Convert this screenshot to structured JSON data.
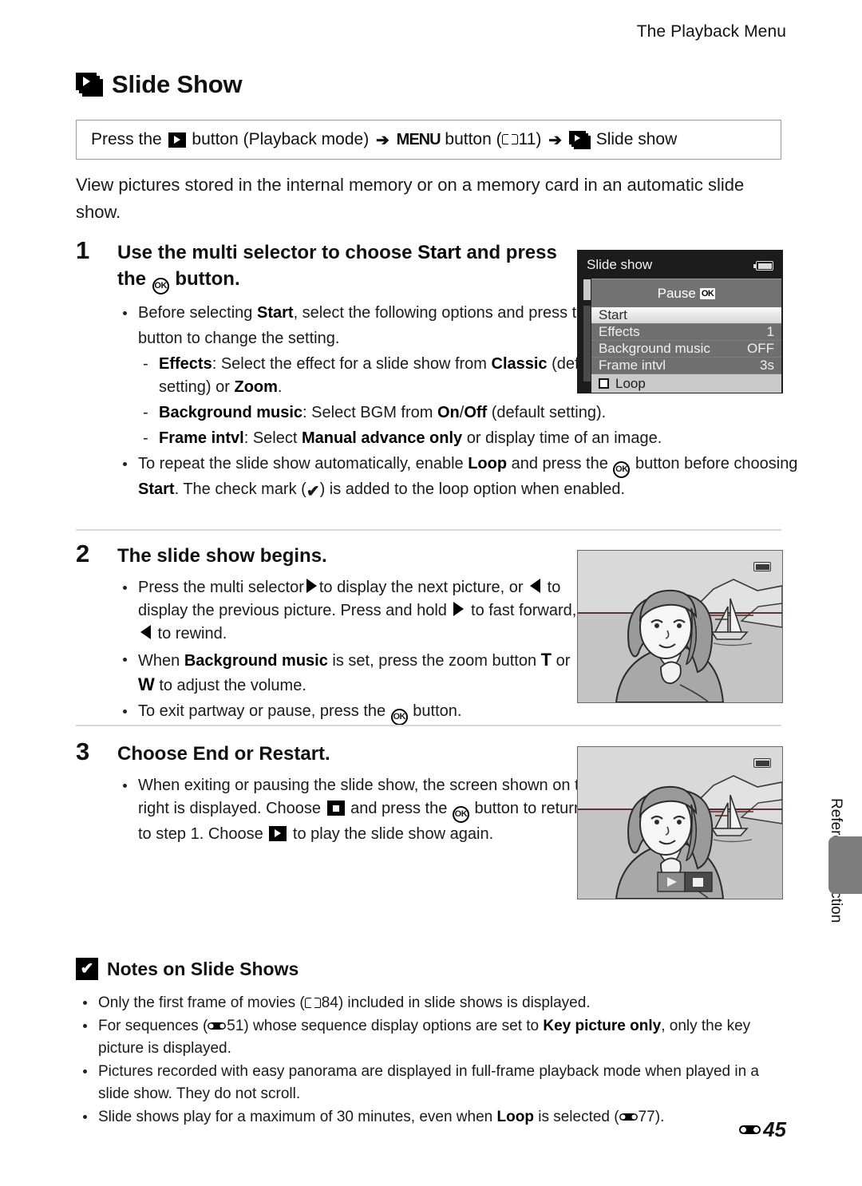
{
  "header": {
    "running_title": "The Playback Menu"
  },
  "title": {
    "text": "Slide Show",
    "icon": "slide-show-icon"
  },
  "path_box": {
    "part1": "Press the",
    "icon1": "playback-button-icon",
    "part2": "button (Playback mode)",
    "arrow1": "➔",
    "menu_word": "MENU",
    "part3": "button (",
    "book_icon": "book-icon",
    "page_ref": "11",
    "part4": ")",
    "arrow2": "➔",
    "icon2": "slide-show-icon",
    "part5": "Slide show"
  },
  "intro": "View pictures stored in the internal memory or on a memory card in an automatic slide show.",
  "steps": [
    {
      "number": "1",
      "heading_a": "Use the multi selector to choose ",
      "heading_b": "Start",
      "heading_c": " and press the ",
      "heading_ok": "OK",
      "heading_d": " button.",
      "bullets": [
        {
          "kind": "bullet",
          "segments": [
            {
              "t": "Before selecting ",
              "b": false
            },
            {
              "t": "Start",
              "b": true
            },
            {
              "t": ", select the following options and press the ",
              "b": false
            },
            {
              "t": "[OK]",
              "b": false,
              "icon": "ok-button-icon"
            },
            {
              "t": " button to change the setting.",
              "b": false
            }
          ]
        },
        {
          "kind": "sub",
          "segments": [
            {
              "t": "Effects",
              "b": true
            },
            {
              "t": ": Select the effect for a slide show from ",
              "b": false
            },
            {
              "t": "Classic",
              "b": true
            },
            {
              "t": " (default setting) or ",
              "b": false
            },
            {
              "t": "Zoom",
              "b": true
            },
            {
              "t": ".",
              "b": false
            }
          ]
        },
        {
          "kind": "sub",
          "segments": [
            {
              "t": "Background music",
              "b": true
            },
            {
              "t": ": Select BGM from ",
              "b": false
            },
            {
              "t": "On",
              "b": true
            },
            {
              "t": "/",
              "b": false
            },
            {
              "t": "Off",
              "b": true
            },
            {
              "t": " (default setting).",
              "b": false
            }
          ]
        },
        {
          "kind": "sub-wide",
          "segments": [
            {
              "t": "Frame intvl",
              "b": true
            },
            {
              "t": ": Select ",
              "b": false
            },
            {
              "t": "Manual advance only",
              "b": true
            },
            {
              "t": " or display time of an image.",
              "b": false
            }
          ]
        },
        {
          "kind": "bullet-wide",
          "segments": [
            {
              "t": "To repeat the slide show automatically, enable ",
              "b": false
            },
            {
              "t": "Loop",
              "b": true
            },
            {
              "t": " and press the ",
              "b": false
            },
            {
              "t": "[OK]",
              "b": false,
              "icon": "ok-button-icon"
            },
            {
              "t": " button before choosing ",
              "b": false
            },
            {
              "t": "Start",
              "b": true
            },
            {
              "t": ". The check mark (",
              "b": false
            },
            {
              "t": "✔",
              "b": false,
              "icon": "check-mark-icon"
            },
            {
              "t": ") is added to the loop option when enabled.",
              "b": false
            }
          ]
        }
      ]
    },
    {
      "number": "2",
      "heading": "The slide show begins."
    },
    {
      "number": "3",
      "heading": "Choose End or Restart."
    }
  ],
  "step2_bullets": [
    "Press the multi selector ▶ to display the next picture, or ◀ to display the previous picture. Press and hold ▶ to fast forward, or ◀ to rewind.",
    "When Background music is set, press the zoom button T or W to adjust the volume.",
    "To exit partway or pause, press the OK button."
  ],
  "step3_bullets": [
    "When exiting or pausing the slide show, the screen shown on the right is displayed. Choose [stop] and press the OK button to return to step 1. Choose [play] to play the slide show again."
  ],
  "camera_menu": {
    "title": "Slide show",
    "battery_icon": "battery-icon",
    "pause_label": "Pause",
    "pause_badge": "OK",
    "rows": [
      {
        "label": "Start",
        "value": "",
        "state": "selected"
      },
      {
        "label": "Effects",
        "value": "1",
        "state": "normal"
      },
      {
        "label": "Background music",
        "value": "OFF",
        "state": "normal"
      },
      {
        "label": "Frame intvl",
        "value": "3s",
        "state": "normal"
      },
      {
        "label": "Loop",
        "value": "",
        "state": "loop"
      }
    ]
  },
  "photos": {
    "photo1": {
      "name": "slide-show-playback-photo",
      "battery_icon": "battery-icon"
    },
    "photo2": {
      "name": "slide-show-paused-photo",
      "battery_icon": "battery-icon",
      "controls": [
        {
          "name": "play-button",
          "selected": false
        },
        {
          "name": "stop-button",
          "selected": true
        }
      ]
    }
  },
  "side_tab": {
    "label": "Reference Section"
  },
  "notes": {
    "icon": "caution-icon",
    "title": "Notes on Slide Shows",
    "items": [
      {
        "segments": [
          {
            "t": "Only the first frame of movies (",
            "b": false
          },
          {
            "t": "BOOK",
            "b": false,
            "icon": "book-icon"
          },
          {
            "t": "84) included in slide shows is displayed.",
            "b": false
          }
        ]
      },
      {
        "segments": [
          {
            "t": "For sequences (",
            "b": false
          },
          {
            "t": "REF",
            "b": false,
            "icon": "reference-icon"
          },
          {
            "t": "51) whose sequence display options are set to ",
            "b": false
          },
          {
            "t": "Key picture only",
            "b": true
          },
          {
            "t": ", only the key picture is displayed.",
            "b": false
          }
        ]
      },
      {
        "segments": [
          {
            "t": "Pictures recorded with easy panorama are displayed in  full-frame playback mode when played in a slide show. They do not scroll.",
            "b": false
          }
        ]
      },
      {
        "segments": [
          {
            "t": "Slide shows play for a maximum of 30 minutes, even when ",
            "b": false
          },
          {
            "t": "Loop",
            "b": true
          },
          {
            "t": " is selected (",
            "b": false
          },
          {
            "t": "REF",
            "b": false,
            "icon": "reference-icon"
          },
          {
            "t": "77).",
            "b": false
          }
        ]
      }
    ]
  },
  "footer": {
    "icon": "reference-icon",
    "page": "45"
  }
}
